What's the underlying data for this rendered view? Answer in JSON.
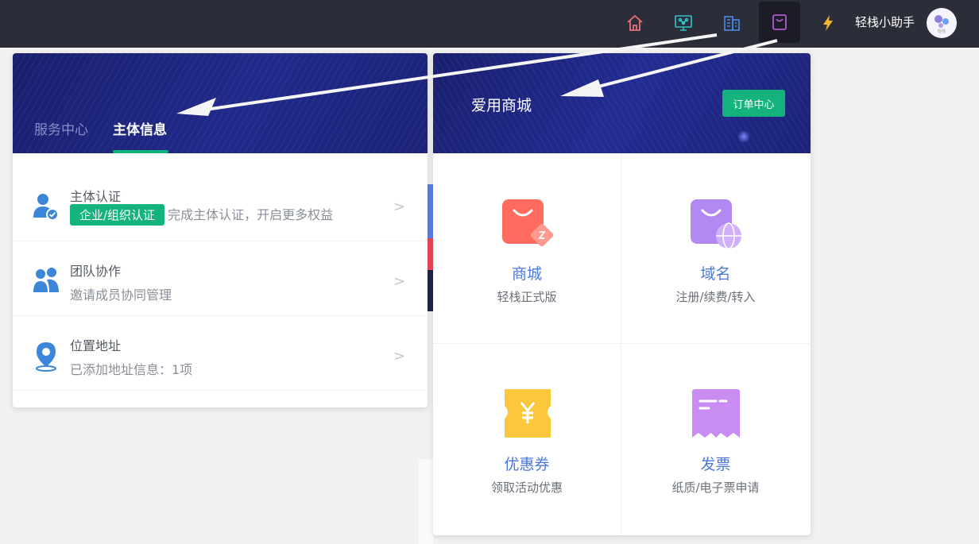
{
  "topbar": {
    "icons": [
      "home-icon",
      "monitor-network-icon",
      "building-icon",
      "shopping-bag-icon",
      "lightning-icon"
    ],
    "user_name": "轻栈小助手",
    "avatar_text": "轻栈"
  },
  "left_panel": {
    "tabs": [
      {
        "label": "服务中心",
        "active": false
      },
      {
        "label": "主体信息",
        "active": true
      }
    ],
    "rows": [
      {
        "title": "主体认证",
        "badge": "企业/组织认证",
        "desc": "完成主体认证，开启更多权益",
        "icon": "user-verified-icon",
        "chevron": ">"
      },
      {
        "title": "团队协作",
        "desc": "邀请成员协同管理",
        "icon": "team-icon",
        "chevron": ">"
      },
      {
        "title": "位置地址",
        "desc": "已添加地址信息：1项",
        "icon": "location-pin-icon",
        "chevron": ">"
      }
    ]
  },
  "right_panel": {
    "title": "爱用商城",
    "order_button": "订单中心",
    "items": [
      {
        "title": "商城",
        "subtitle": "轻栈正式版",
        "icon": "shop-bag-icon"
      },
      {
        "title": "域名",
        "subtitle": "注册/续费/转入",
        "icon": "domain-globe-icon"
      },
      {
        "title": "优惠券",
        "subtitle": "领取活动优惠",
        "icon": "coupon-icon"
      },
      {
        "title": "发票",
        "subtitle": "纸质/电子票申请",
        "icon": "invoice-icon"
      }
    ]
  },
  "colors": {
    "topbar_bg": "#2b2d38",
    "banner_bg": "#1e2680",
    "accent_green": "#14b37d",
    "link_blue": "#4d78d8"
  }
}
